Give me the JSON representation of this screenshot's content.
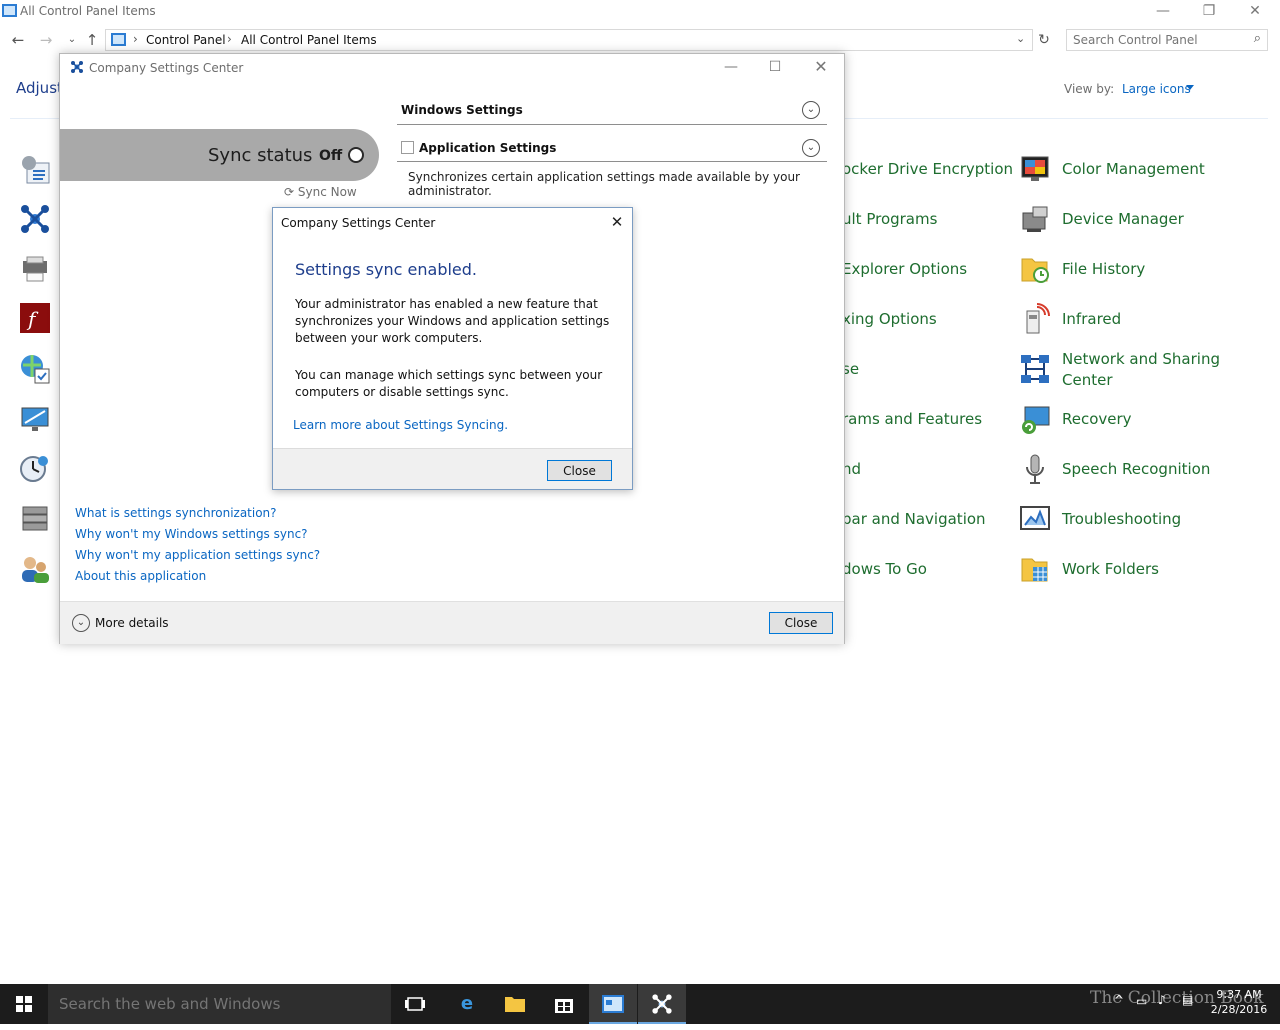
{
  "window": {
    "title": "All Control Panel Items",
    "controls": {
      "minimize": "—",
      "restore": "❐",
      "close": "✕"
    }
  },
  "address": {
    "crumbs": [
      "Control Panel",
      "All Control Panel Items"
    ],
    "search_placeholder": "Search Control Panel"
  },
  "content": {
    "heading_partial": "Adjust",
    "view_by_label": "View by:",
    "view_by_value": "Large icons"
  },
  "items_partial": [
    "ocker Drive Encryption",
    "ult Programs",
    "Explorer Options",
    "xing Options",
    "se",
    "rams and Features",
    "nd",
    "bar and Navigation",
    "dows To Go"
  ],
  "items_right": [
    {
      "label": "Color Management",
      "icon": "color-management-icon"
    },
    {
      "label": "Device Manager",
      "icon": "device-manager-icon"
    },
    {
      "label": "File History",
      "icon": "file-history-icon"
    },
    {
      "label": "Infrared",
      "icon": "infrared-icon"
    },
    {
      "label": "Network and Sharing",
      "label2": "Center",
      "icon": "network-sharing-icon"
    },
    {
      "label": "Recovery",
      "icon": "recovery-icon"
    },
    {
      "label": "Speech Recognition",
      "icon": "speech-recognition-icon"
    },
    {
      "label": "Troubleshooting",
      "icon": "troubleshooting-icon"
    },
    {
      "label": "Work Folders",
      "icon": "work-folders-icon"
    }
  ],
  "csc": {
    "title": "Company Settings Center",
    "sync_status_label": "Sync status",
    "sync_status_value": "Off",
    "sync_now": "Sync Now",
    "windows_settings": "Windows Settings",
    "application_settings": "Application Settings",
    "application_desc": "Synchronizes certain application settings made available by your administrator.",
    "links": [
      "What is settings synchronization?",
      "Why won't my Windows settings sync?",
      "Why won't my application settings sync?",
      "About this application"
    ],
    "more_details": "More details",
    "close": "Close"
  },
  "dialog": {
    "title": "Company Settings Center",
    "heading": "Settings sync enabled.",
    "p1": "Your administrator has enabled a new feature that synchronizes your Windows and application settings between your work computers.",
    "p2": "You can manage which settings sync between your computers or disable settings sync.",
    "link": "Learn more about Settings Syncing.",
    "close": "Close"
  },
  "taskbar": {
    "search_placeholder": "Search the web and Windows",
    "time": "9:37 AM",
    "date": "2/28/2016",
    "watermark": "The Collection Book"
  },
  "colors": {
    "accent": "#0a66c2",
    "cp_item_text": "#1e6d2f",
    "heading_blue": "#1e3e8c",
    "taskbar": "#1c1c1c"
  }
}
